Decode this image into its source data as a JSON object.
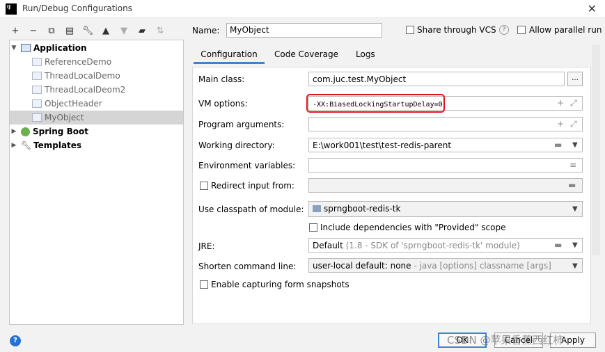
{
  "window": {
    "title": "Run/Debug Configurations",
    "app_icon_text": "IJ"
  },
  "toolbar": [
    "plus-icon",
    "minus-icon",
    "copy-icon",
    "save-icon",
    "wrench-icon",
    "arrow-up-icon",
    "arrow-down-icon",
    "folder-add-icon",
    "sort-icon"
  ],
  "tree": {
    "items": [
      {
        "label": "Application",
        "level": 0,
        "expanded": true,
        "icon": "application-icon"
      },
      {
        "label": "ReferenceDemo",
        "level": 1,
        "icon": "class-icon"
      },
      {
        "label": "ThreadLocalDemo",
        "level": 1,
        "icon": "class-icon"
      },
      {
        "label": "ThreadLocalDeom2",
        "level": 1,
        "icon": "class-icon"
      },
      {
        "label": "ObjectHeader",
        "level": 1,
        "icon": "class-icon"
      },
      {
        "label": "MyObject",
        "level": 1,
        "icon": "class-icon",
        "selected": true
      },
      {
        "label": "Spring Boot",
        "level": 0,
        "expanded": false,
        "icon": "spring-icon"
      },
      {
        "label": "Templates",
        "level": 0,
        "expanded": false,
        "icon": "wrench-icon"
      }
    ]
  },
  "header": {
    "name_label": "Name:",
    "name_value": "MyObject",
    "share_vcs_label": "Share through VCS",
    "allow_parallel_label": "Allow parallel run"
  },
  "tabs": [
    "Configuration",
    "Code Coverage",
    "Logs"
  ],
  "form": {
    "main_class_label": "Main class:",
    "main_class_value": "com.juc.test.MyObject",
    "browse_label": "...",
    "vm_options_label": "VM options:",
    "vm_options_value": "-XX:BiasedLockingStartupDelay=0",
    "program_args_label": "Program arguments:",
    "working_dir_label": "Working directory:",
    "working_dir_value": "E:\\work001\\test\\test-redis-parent",
    "env_vars_label": "Environment variables:",
    "redirect_label": "Redirect input from:",
    "classpath_label": "Use classpath of module:",
    "classpath_value": "sprngboot-redis-tk",
    "include_deps_label": "Include dependencies with \"Provided\" scope",
    "jre_label": "JRE:",
    "jre_value": "Default",
    "jre_suffix": "(1.8 - SDK of 'sprngboot-redis-tk' module)",
    "shorten_label": "Shorten command line:",
    "shorten_value": "user-local default: none",
    "shorten_suffix": "- java [options] classname [args]",
    "capture_label": "Enable capturing form snapshots"
  },
  "footer": {
    "help": "?",
    "ok": "OK",
    "cancel": "Cancel",
    "apply": "Apply",
    "watermark": "CSDN @苹果香蕉西红柿"
  },
  "colors": {
    "accent": "#4083c9",
    "highlight": "#e0131a",
    "selection": "#d5d5d5"
  }
}
